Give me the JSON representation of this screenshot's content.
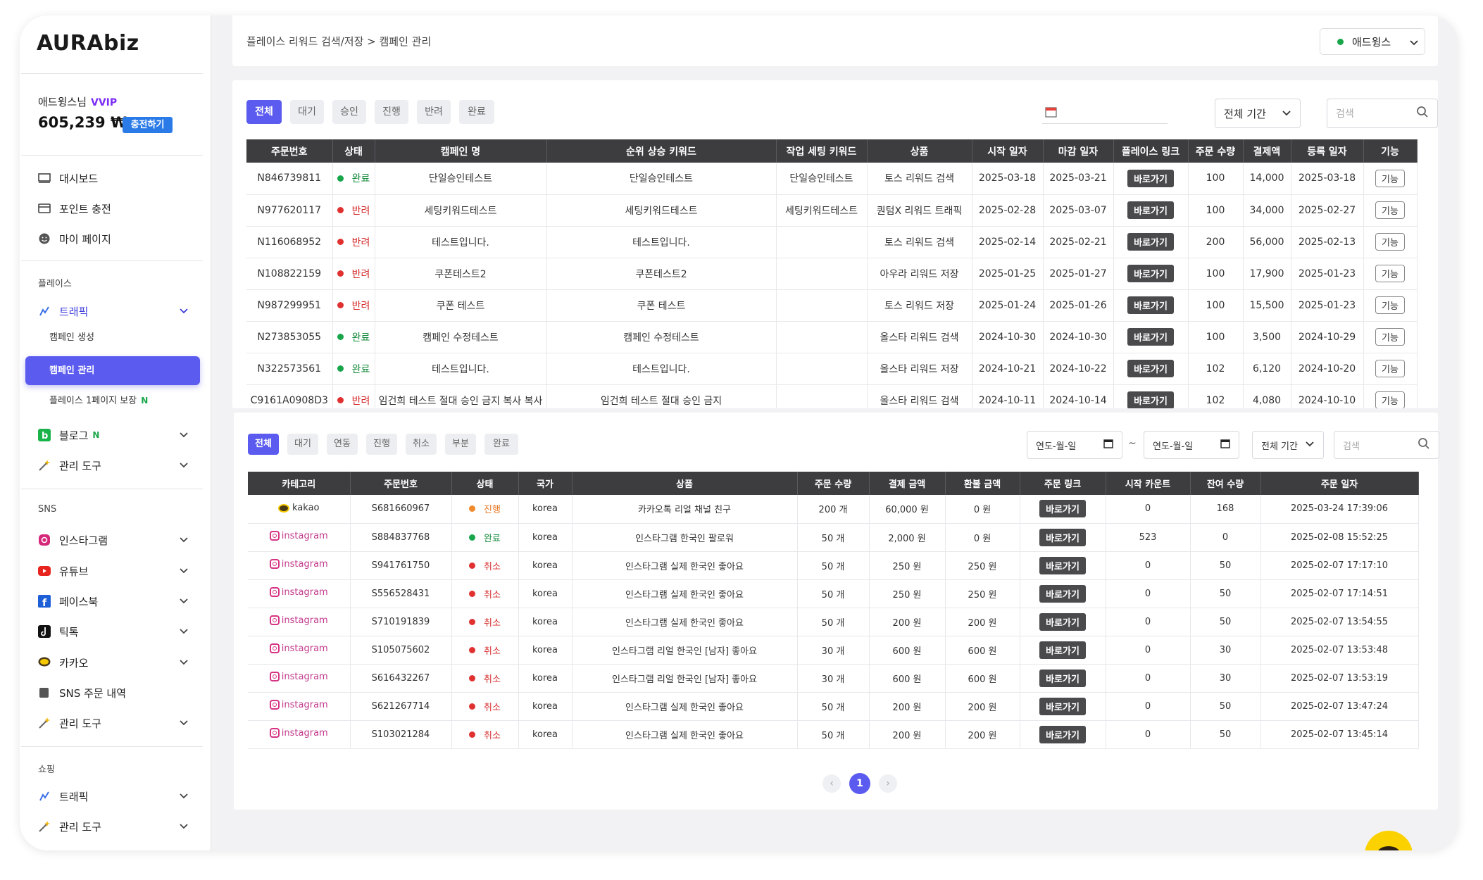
{
  "app": {
    "logo": "AURAbiz"
  },
  "user": {
    "name": "애드윙스님",
    "tier": "VVIP",
    "points": "605,239 ₩",
    "charge_label": "충전하기"
  },
  "sidebar": {
    "top_items": [
      {
        "label": "대시보드",
        "icon": "monitor-icon"
      },
      {
        "label": "포인트 충전",
        "icon": "card-icon"
      },
      {
        "label": "마이 페이지",
        "icon": "smile-icon"
      }
    ],
    "section_place": "플레이스",
    "place_traffic": "트래픽",
    "place_sub_create": "캠페인 생성",
    "place_sub_manage": "캠페인 관리",
    "place_sub_page": "플레이스 1페이지 보장",
    "place_sub_page_tag": "N",
    "blog": "블로그",
    "blog_tag": "N",
    "tools1": "관리 도구",
    "section_sns": "SNS",
    "sns_items": [
      {
        "label": "인스타그램",
        "icon": "instagram-icon"
      },
      {
        "label": "유튜브",
        "icon": "youtube-icon"
      },
      {
        "label": "페이스북",
        "icon": "facebook-icon"
      },
      {
        "label": "틱톡",
        "icon": "tiktok-icon"
      },
      {
        "label": "카카오",
        "icon": "kakao-icon"
      }
    ],
    "sns_orders": "SNS 주문 내역",
    "tools2": "관리 도구",
    "section_shopping": "쇼핑",
    "shop_traffic": "트래픽",
    "tools3": "관리 도구"
  },
  "header": {
    "breadcrumb": "플레이스 리워드 검색/저장 > 캠페인 관리",
    "account": "애드윙스"
  },
  "panel1": {
    "filters": [
      "전체",
      "대기",
      "승인",
      "진행",
      "반려",
      "완료"
    ],
    "period": "전체 기간",
    "search_placeholder": "검색",
    "columns": [
      "주문번호",
      "상태",
      "캠페인 명",
      "순위 상승 키워드",
      "작업 세팅 키워드",
      "상품",
      "시작 일자",
      "마감 일자",
      "플레이스 링크",
      "주문 수량",
      "결제액",
      "등록 일자",
      "기능"
    ],
    "rows": [
      {
        "id": "N846739811",
        "status": "완료",
        "color": "green",
        "name": "단일승인테스트",
        "rank_kw": "단일승인테스트",
        "set_kw": "단일승인테스트",
        "product": "토스 리워드 검색",
        "start": "2025-03-18",
        "end": "2025-03-21",
        "link": "바로가기",
        "qty": "100",
        "pay": "14,000",
        "reg": "2025-03-18",
        "fn": "기능"
      },
      {
        "id": "N977620117",
        "status": "반려",
        "color": "red",
        "name": "세팅키워드테스트",
        "rank_kw": "세팅키워드테스트",
        "set_kw": "세팅키워드테스트",
        "product": "퀀텀X 리워드 트래픽",
        "start": "2025-02-28",
        "end": "2025-03-07",
        "link": "바로가기",
        "qty": "100",
        "pay": "34,000",
        "reg": "2025-02-27",
        "fn": "기능"
      },
      {
        "id": "N116068952",
        "status": "반려",
        "color": "red",
        "name": "테스트입니다.",
        "rank_kw": "테스트입니다.",
        "set_kw": "",
        "product": "토스 리워드 검색",
        "start": "2025-02-14",
        "end": "2025-02-21",
        "link": "바로가기",
        "qty": "200",
        "pay": "56,000",
        "reg": "2025-02-13",
        "fn": "기능"
      },
      {
        "id": "N108822159",
        "status": "반려",
        "color": "red",
        "name": "쿠폰테스트2",
        "rank_kw": "쿠폰테스트2",
        "set_kw": "",
        "product": "아우라 리워드 저장",
        "start": "2025-01-25",
        "end": "2025-01-27",
        "link": "바로가기",
        "qty": "100",
        "pay": "17,900",
        "reg": "2025-01-23",
        "fn": "기능"
      },
      {
        "id": "N987299951",
        "status": "반려",
        "color": "red",
        "name": "쿠폰 테스트",
        "rank_kw": "쿠폰 테스트",
        "set_kw": "",
        "product": "토스 리워드 저장",
        "start": "2025-01-24",
        "end": "2025-01-26",
        "link": "바로가기",
        "qty": "100",
        "pay": "15,500",
        "reg": "2025-01-23",
        "fn": "기능"
      },
      {
        "id": "N273853055",
        "status": "완료",
        "color": "green",
        "name": "캠페인 수정테스트",
        "rank_kw": "캠페인 수정테스트",
        "set_kw": "",
        "product": "올스타 리워드 검색",
        "start": "2024-10-30",
        "end": "2024-10-30",
        "link": "바로가기",
        "qty": "100",
        "pay": "3,500",
        "reg": "2024-10-29",
        "fn": "기능"
      },
      {
        "id": "N322573561",
        "status": "완료",
        "color": "green",
        "name": "테스트입니다.",
        "rank_kw": "테스트입니다.",
        "set_kw": "",
        "product": "올스타 리워드 저장",
        "start": "2024-10-21",
        "end": "2024-10-22",
        "link": "바로가기",
        "qty": "102",
        "pay": "6,120",
        "reg": "2024-10-20",
        "fn": "기능"
      },
      {
        "id": "C9161A0908D3",
        "status": "반려",
        "color": "red",
        "name": "임건희 테스트 절대 승인 금지 복사 복사",
        "rank_kw": "임건희 테스트 절대 승인 금지",
        "set_kw": "",
        "product": "올스타 리워드 검색",
        "start": "2024-10-11",
        "end": "2024-10-14",
        "link": "바로가기",
        "qty": "102",
        "pay": "4,080",
        "reg": "2024-10-10",
        "fn": "기능"
      }
    ]
  },
  "panel2": {
    "filters": [
      "전체",
      "대기",
      "연동",
      "진행",
      "취소",
      "부분",
      "완료"
    ],
    "date_placeholder": "연도-월-일",
    "tilde": "~",
    "period": "전체 기간",
    "search_placeholder": "검색",
    "columns": [
      "카테고리",
      "주문번호",
      "상태",
      "국가",
      "상품",
      "주문 수량",
      "결제 금액",
      "환불 금액",
      "주문 링크",
      "시작 카운트",
      "잔여 수량",
      "주문 일자"
    ],
    "rows": [
      {
        "cat": "kakao",
        "id": "S681660967",
        "status": "진행",
        "color": "orange",
        "country": "korea",
        "product": "카카오톡 리얼 채널 친구",
        "qty": "200 개",
        "pay": "60,000 원",
        "refund": "0 원",
        "link": "바로가기",
        "start": "0",
        "remain": "168",
        "date": "2025-03-24 17:39:06"
      },
      {
        "cat": "instagram",
        "id": "S884837768",
        "status": "완료",
        "color": "green",
        "country": "korea",
        "product": "인스타그램 한국인 팔로워",
        "qty": "50 개",
        "pay": "2,000 원",
        "refund": "0 원",
        "link": "바로가기",
        "start": "523",
        "remain": "0",
        "date": "2025-02-08 15:52:25"
      },
      {
        "cat": "instagram",
        "id": "S941761750",
        "status": "취소",
        "color": "red",
        "country": "korea",
        "product": "인스타그램 실제 한국인 좋아요",
        "qty": "50 개",
        "pay": "250 원",
        "refund": "250 원",
        "link": "바로가기",
        "start": "0",
        "remain": "50",
        "date": "2025-02-07 17:17:10"
      },
      {
        "cat": "instagram",
        "id": "S556528431",
        "status": "취소",
        "color": "red",
        "country": "korea",
        "product": "인스타그램 실제 한국인 좋아요",
        "qty": "50 개",
        "pay": "250 원",
        "refund": "250 원",
        "link": "바로가기",
        "start": "0",
        "remain": "50",
        "date": "2025-02-07 17:14:51"
      },
      {
        "cat": "instagram",
        "id": "S710191839",
        "status": "취소",
        "color": "red",
        "country": "korea",
        "product": "인스타그램 실제 한국인 좋아요",
        "qty": "50 개",
        "pay": "200 원",
        "refund": "200 원",
        "link": "바로가기",
        "start": "0",
        "remain": "50",
        "date": "2025-02-07 13:54:55"
      },
      {
        "cat": "instagram",
        "id": "S105075602",
        "status": "취소",
        "color": "red",
        "country": "korea",
        "product": "인스타그램 리얼 한국인 [남자] 좋아요",
        "qty": "30 개",
        "pay": "600 원",
        "refund": "600 원",
        "link": "바로가기",
        "start": "0",
        "remain": "30",
        "date": "2025-02-07 13:53:48"
      },
      {
        "cat": "instagram",
        "id": "S616432267",
        "status": "취소",
        "color": "red",
        "country": "korea",
        "product": "인스타그램 리얼 한국인 [남자] 좋아요",
        "qty": "30 개",
        "pay": "600 원",
        "refund": "600 원",
        "link": "바로가기",
        "start": "0",
        "remain": "30",
        "date": "2025-02-07 13:53:19"
      },
      {
        "cat": "instagram",
        "id": "S621267714",
        "status": "취소",
        "color": "red",
        "country": "korea",
        "product": "인스타그램 실제 한국인 좋아요",
        "qty": "50 개",
        "pay": "200 원",
        "refund": "200 원",
        "link": "바로가기",
        "start": "0",
        "remain": "50",
        "date": "2025-02-07 13:47:24"
      },
      {
        "cat": "instagram",
        "id": "S103021284",
        "status": "취소",
        "color": "red",
        "country": "korea",
        "product": "인스타그램 실제 한국인 좋아요",
        "qty": "50 개",
        "pay": "200 원",
        "refund": "200 원",
        "link": "바로가기",
        "start": "0",
        "remain": "50",
        "date": "2025-02-07 13:45:14"
      }
    ],
    "pagination": {
      "current": "1"
    }
  },
  "colors": {
    "accent": "#5b5bf0",
    "charge": "#2a7be8",
    "vvip": "#7b2cf6",
    "ok": "#19a64a",
    "reject": "#e03131",
    "progress": "#f08a2c"
  }
}
